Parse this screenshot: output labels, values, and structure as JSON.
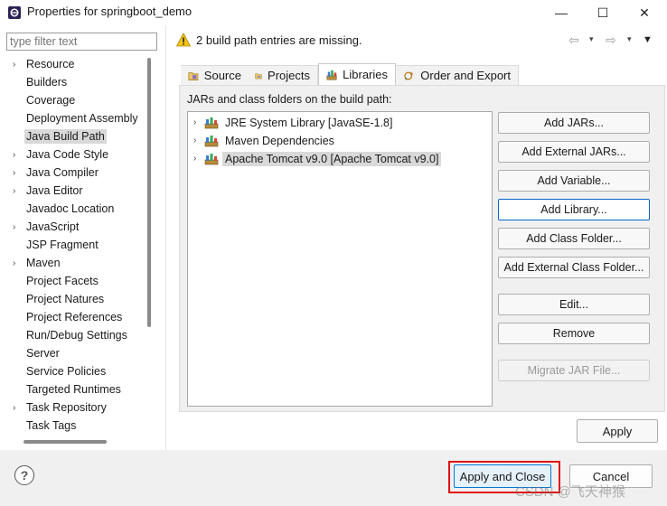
{
  "window": {
    "title": "Properties for springboot_demo",
    "min_glyph": "—",
    "max_glyph": "☐",
    "close_glyph": "✕"
  },
  "filter": {
    "placeholder": "type filter text",
    "value": ""
  },
  "nav": {
    "items": [
      {
        "label": "Resource",
        "expandable": true
      },
      {
        "label": "Builders",
        "expandable": false
      },
      {
        "label": "Coverage",
        "expandable": false
      },
      {
        "label": "Deployment Assembly",
        "expandable": false
      },
      {
        "label": "Java Build Path",
        "expandable": false,
        "selected": true
      },
      {
        "label": "Java Code Style",
        "expandable": true
      },
      {
        "label": "Java Compiler",
        "expandable": true
      },
      {
        "label": "Java Editor",
        "expandable": true
      },
      {
        "label": "Javadoc Location",
        "expandable": false
      },
      {
        "label": "JavaScript",
        "expandable": true
      },
      {
        "label": "JSP Fragment",
        "expandable": false
      },
      {
        "label": "Maven",
        "expandable": true
      },
      {
        "label": "Project Facets",
        "expandable": false
      },
      {
        "label": "Project Natures",
        "expandable": false
      },
      {
        "label": "Project References",
        "expandable": false
      },
      {
        "label": "Run/Debug Settings",
        "expandable": false
      },
      {
        "label": "Server",
        "expandable": false
      },
      {
        "label": "Service Policies",
        "expandable": false
      },
      {
        "label": "Targeted Runtimes",
        "expandable": false
      },
      {
        "label": "Task Repository",
        "expandable": true
      },
      {
        "label": "Task Tags",
        "expandable": false
      }
    ]
  },
  "header": {
    "message": "2 build path entries are missing.",
    "back_glyph": "⇦",
    "forward_glyph": "⇨",
    "dropdown_glyph": "▾",
    "menu_glyph": "▼"
  },
  "tabs": [
    {
      "label": "Source",
      "icon": "source-folder-icon",
      "active": false
    },
    {
      "label": "Projects",
      "icon": "projects-folder-icon",
      "active": false
    },
    {
      "label": "Libraries",
      "icon": "libraries-icon",
      "active": true
    },
    {
      "label": "Order and Export",
      "icon": "order-export-icon",
      "active": false
    }
  ],
  "libraries": {
    "label": "JARs and class folders on the build path:",
    "entries": [
      {
        "label": "JRE System Library [JavaSE-1.8]",
        "icon": "library-icon"
      },
      {
        "label": "Maven Dependencies",
        "icon": "library-icon"
      },
      {
        "label": "Apache Tomcat v9.0 [Apache Tomcat v9.0]",
        "icon": "library-icon",
        "selected": true
      }
    ],
    "buttons": {
      "add_jars": "Add JARs...",
      "add_external_jars": "Add External JARs...",
      "add_variable": "Add Variable...",
      "add_library": "Add Library...",
      "add_class_folder": "Add Class Folder...",
      "add_external_class_folder": "Add External Class Folder...",
      "edit": "Edit...",
      "remove": "Remove",
      "migrate_jar": "Migrate JAR File..."
    }
  },
  "apply_label": "Apply",
  "footer": {
    "help_glyph": "?",
    "apply_close_label": "Apply and Close",
    "cancel_label": "Cancel"
  },
  "watermark": "CSDN @飞天神猴",
  "colors": {
    "accent_blue": "#0078d7",
    "highlight_red": "#e01010",
    "selection_gray": "#d9d9d9",
    "warning_yellow": "#f5c518"
  }
}
